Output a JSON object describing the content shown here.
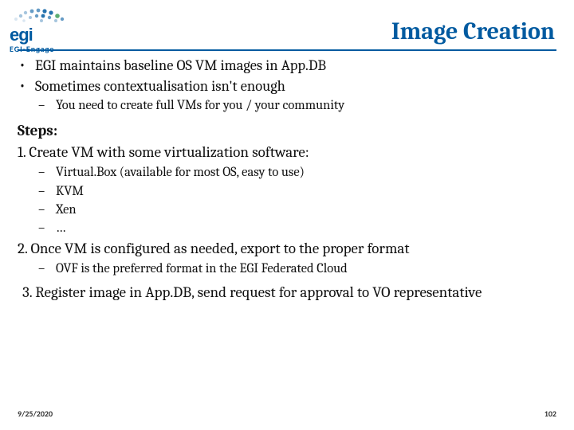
{
  "branding": {
    "org": "egi",
    "subbrand": "EGI-Engage"
  },
  "title": "Image Creation",
  "bullets_top": [
    "EGI maintains baseline OS VM images in App.DB",
    "Sometimes contextualisation isn't enough"
  ],
  "bullets_top_sub": [
    "You need to create full VMs for you / your community"
  ],
  "steps_label": "Steps:",
  "step1": "1. Create VM with some virtualization software:",
  "step1_items": [
    "Virtual.Box (available for most OS, easy to use)",
    "KVM",
    "Xen",
    "…"
  ],
  "step2": "2. Once VM is configured as needed, export to the proper format",
  "step2_items": [
    "OVF is the preferred format in the EGI Federated Cloud"
  ],
  "step3": "3. Register image in App.DB, send request for approval to VO representative",
  "footer": {
    "date": "9/25/2020",
    "page": "102"
  }
}
